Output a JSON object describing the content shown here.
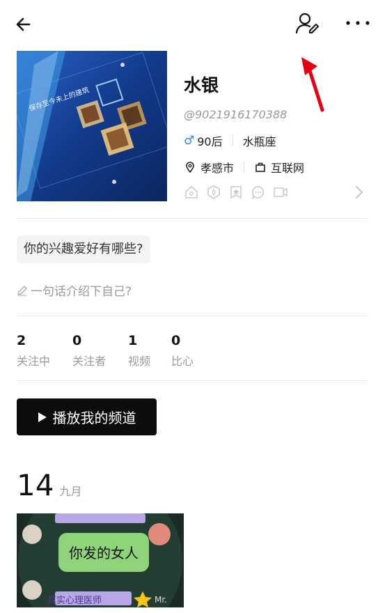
{
  "topbar": {
    "back_icon": "arrow-left-icon",
    "edit_icon": "user-edit-icon",
    "more_icon": "ellipsis-icon"
  },
  "profile": {
    "name": "水银",
    "handle": "@9021916170388",
    "gender_symbol": "♂",
    "age_group": "90后",
    "zodiac": "水瓶座",
    "location": "孝感市",
    "industry": "互联网",
    "badge_icons": [
      "home-badge-icon",
      "shield-badge-icon",
      "star-badge-icon",
      "chat-badge-icon",
      "video-badge-icon"
    ]
  },
  "hobby_prompt": "你的兴趣爱好有哪些?",
  "bio_prompt": "一句话介绍下自己?",
  "stats": [
    {
      "value": "2",
      "label": "关注中"
    },
    {
      "value": "0",
      "label": "关注者"
    },
    {
      "value": "1",
      "label": "视频"
    },
    {
      "value": "0",
      "label": "比心"
    }
  ],
  "play_button": {
    "label": "播放我的频道"
  },
  "feed": {
    "day": "14",
    "month": "九月",
    "thumb_caption": "你发的女人",
    "thumb_banner": "真实心理医师",
    "thumb_banner_suffix": "Mr."
  },
  "avatar_text": {
    "line1": "保存至今未上的建筑"
  },
  "colors": {
    "accent_blue": "#2d8cf0",
    "annotation_red": "#e60012",
    "button_dark": "#0c0c0c"
  }
}
